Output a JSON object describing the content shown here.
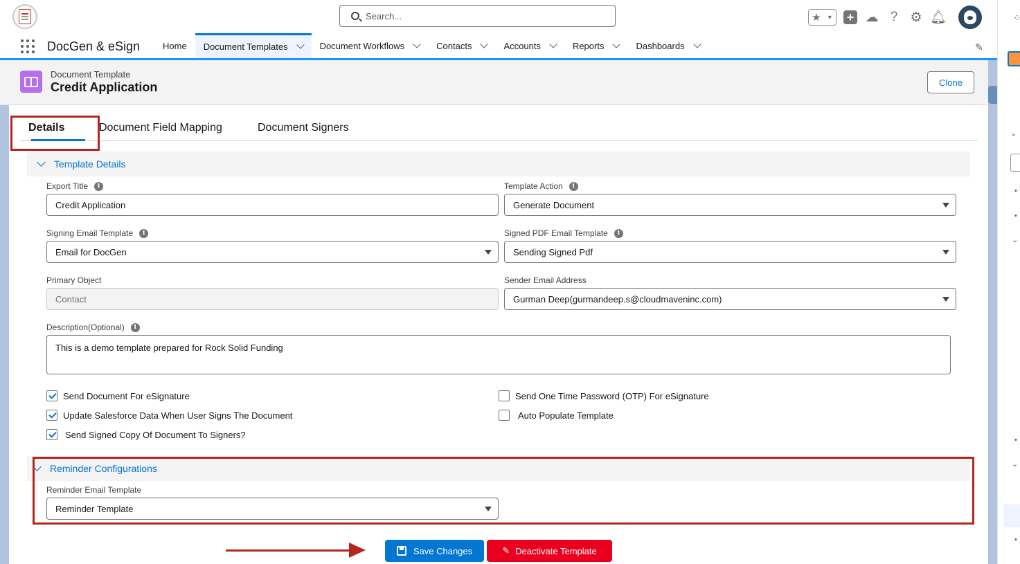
{
  "header": {
    "search_placeholder": "Search...",
    "icons": [
      "favorites-star-icon",
      "add-icon",
      "trailhead-icon",
      "help-icon",
      "setup-gear-icon",
      "notifications-bell-icon",
      "user-avatar"
    ]
  },
  "nav": {
    "app_name": "DocGen & eSign",
    "items": [
      {
        "label": "Home",
        "dropdown": false,
        "active": false
      },
      {
        "label": "Document Templates",
        "dropdown": true,
        "active": true
      },
      {
        "label": "Document Workflows",
        "dropdown": true,
        "active": false
      },
      {
        "label": "Contacts",
        "dropdown": true,
        "active": false
      },
      {
        "label": "Accounts",
        "dropdown": true,
        "active": false
      },
      {
        "label": "Reports",
        "dropdown": true,
        "active": false
      },
      {
        "label": "Dashboards",
        "dropdown": true,
        "active": false
      }
    ]
  },
  "record": {
    "object_type": "Document Template",
    "title": "Credit Application",
    "clone_label": "Clone"
  },
  "tabs": [
    {
      "label": "Details",
      "active": true
    },
    {
      "label": "Document Field Mapping",
      "active": false
    },
    {
      "label": "Document Signers",
      "active": false
    }
  ],
  "template_details": {
    "section_title": "Template Details",
    "export_title": {
      "label": "Export Title",
      "value": "Credit Application"
    },
    "template_action": {
      "label": "Template Action",
      "value": "Generate Document"
    },
    "signing_email_template": {
      "label": "Signing Email Template",
      "value": "Email for DocGen"
    },
    "signed_pdf_email_template": {
      "label": "Signed PDF Email Template",
      "value": "Sending Signed Pdf"
    },
    "primary_object": {
      "label": "Primary Object",
      "value": "Contact"
    },
    "sender_email_address": {
      "label": "Sender Email Address",
      "value": "Gurman Deep(gurmandeep.s@cloudmaveninc.com)"
    },
    "description": {
      "label": "Description(Optional)",
      "value": "This is a demo template prepared for Rock Solid Funding"
    },
    "checkboxes": {
      "send_for_esignature": {
        "label": "Send Document For eSignature",
        "checked": true
      },
      "update_salesforce": {
        "label": "Update Salesforce Data When User Signs The Document",
        "checked": true
      },
      "send_signed_copy": {
        "label": "Send Signed Copy Of Document To Signers?",
        "checked": true
      },
      "send_otp": {
        "label": "Send One Time Password (OTP) For eSignature",
        "checked": false
      },
      "auto_populate": {
        "label": "Auto Populate Template",
        "checked": false
      }
    }
  },
  "reminder": {
    "section_title": "Reminder Configurations",
    "reminder_email_template": {
      "label": "Reminder Email Template",
      "value": "Reminder Template"
    }
  },
  "actions": {
    "save_label": "Save Changes",
    "deactivate_label": "Deactivate Template"
  },
  "colors": {
    "brand": "#0176d3",
    "highlight": "#b3261e",
    "destructive": "#ea001e",
    "record_icon": "#b66eef"
  }
}
